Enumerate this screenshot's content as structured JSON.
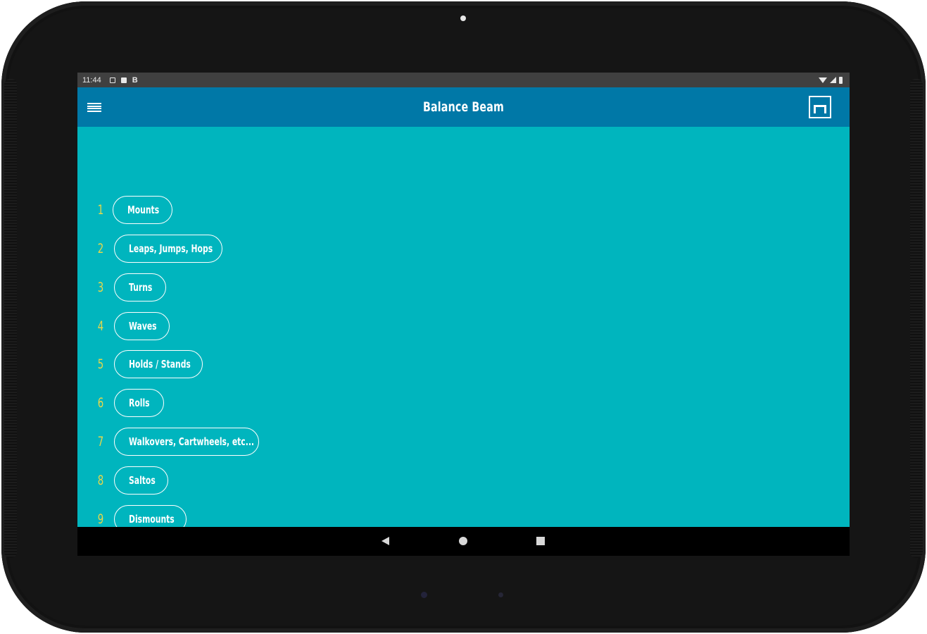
{
  "status_bar": {
    "time": "11:44",
    "notification_letter": "B"
  },
  "app_bar": {
    "title": "Balance Beam",
    "menu_icon": "hamburger-menu-icon",
    "action_icon": "balance-beam-icon"
  },
  "skills": [
    {
      "number": "1",
      "label": "Mounts"
    },
    {
      "number": "2",
      "label": "Leaps, Jumps, Hops"
    },
    {
      "number": "3",
      "label": "Turns"
    },
    {
      "number": "4",
      "label": "Waves"
    },
    {
      "number": "5",
      "label": "Holds / Stands"
    },
    {
      "number": "6",
      "label": "Rolls"
    },
    {
      "number": "7",
      "label": "Walkovers, Cartwheels, etc..."
    },
    {
      "number": "8",
      "label": "Saltos"
    },
    {
      "number": "9",
      "label": "Dismounts"
    }
  ],
  "colors": {
    "content_background": "#00b5be",
    "app_bar": "#0078a7",
    "number_accent": "#e8d84a",
    "pill_border": "#ffffff"
  }
}
